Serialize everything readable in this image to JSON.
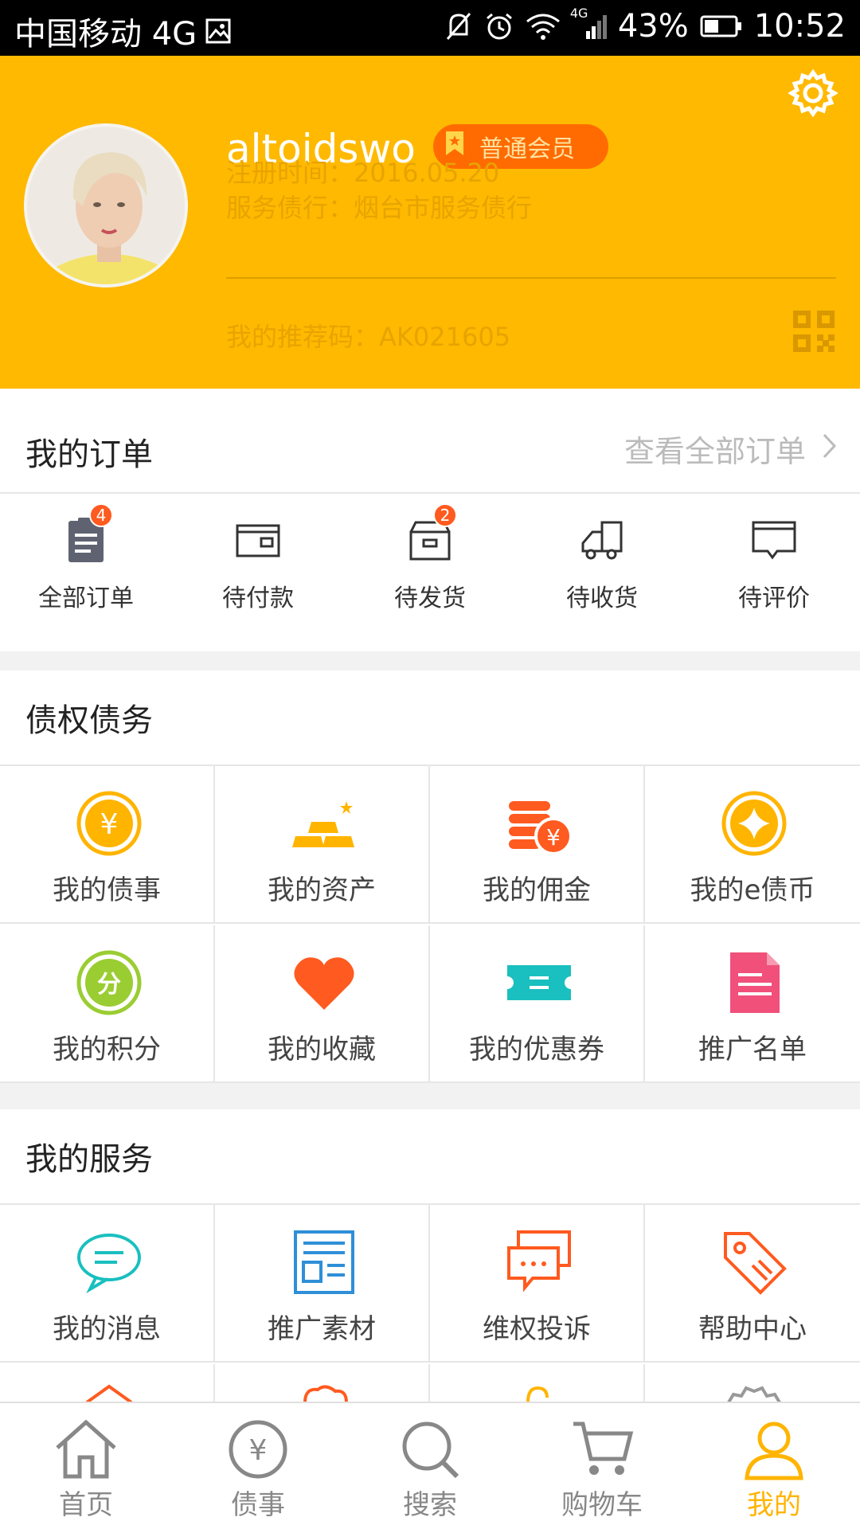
{
  "colors": {
    "brand": "#ffb900",
    "accent_orange": "#ff5a1f",
    "member_badge": "#ff6b00",
    "nav_active": "#ffb400",
    "teal": "#1abfbf",
    "pink": "#f0507a",
    "lime": "#9acd32"
  },
  "status_bar": {
    "carrier": "中国移动 4G",
    "network_small": "4G",
    "battery": "43%",
    "time": "10:52"
  },
  "profile": {
    "username": "altoidswo",
    "member_level": "普通会员",
    "register_label": "注册时间：",
    "register_date": "2016.05.20",
    "branch_label": "服务债行：",
    "branch_name": "烟台市服务债行",
    "referral_label": "我的推荐码：",
    "referral_code": "AK021605"
  },
  "orders": {
    "title": "我的订单",
    "view_all": "查看全部订单",
    "items": [
      {
        "label": "全部订单",
        "icon": "clipboard-icon",
        "badge": "4"
      },
      {
        "label": "待付款",
        "icon": "wallet-icon"
      },
      {
        "label": "待发货",
        "icon": "box-icon",
        "badge": "2"
      },
      {
        "label": "待收货",
        "icon": "truck-icon"
      },
      {
        "label": "待评价",
        "icon": "comment-icon"
      }
    ]
  },
  "debt": {
    "title": "债权债务",
    "items": [
      {
        "label": "我的债事",
        "icon": "yuan-coin-icon"
      },
      {
        "label": "我的资产",
        "icon": "gold-bars-icon"
      },
      {
        "label": "我的佣金",
        "icon": "coin-stack-icon"
      },
      {
        "label": "我的e债币",
        "icon": "star-coin-icon"
      },
      {
        "label": "我的积分",
        "icon": "points-icon"
      },
      {
        "label": "我的收藏",
        "icon": "heart-icon"
      },
      {
        "label": "我的优惠券",
        "icon": "coupon-icon"
      },
      {
        "label": "推广名单",
        "icon": "document-icon"
      }
    ]
  },
  "services": {
    "title": "我的服务",
    "items": [
      {
        "label": "我的消息",
        "icon": "chat-bubble-icon"
      },
      {
        "label": "推广素材",
        "icon": "newspaper-icon"
      },
      {
        "label": "维权投诉",
        "icon": "complaint-icon"
      },
      {
        "label": "帮助中心",
        "icon": "tag-icon"
      }
    ]
  },
  "bottom_nav": [
    {
      "label": "首页",
      "icon": "home-icon"
    },
    {
      "label": "债事",
      "icon": "yuan-circle-icon"
    },
    {
      "label": "搜索",
      "icon": "search-icon"
    },
    {
      "label": "购物车",
      "icon": "cart-icon"
    },
    {
      "label": "我的",
      "icon": "user-icon",
      "active": true
    }
  ]
}
